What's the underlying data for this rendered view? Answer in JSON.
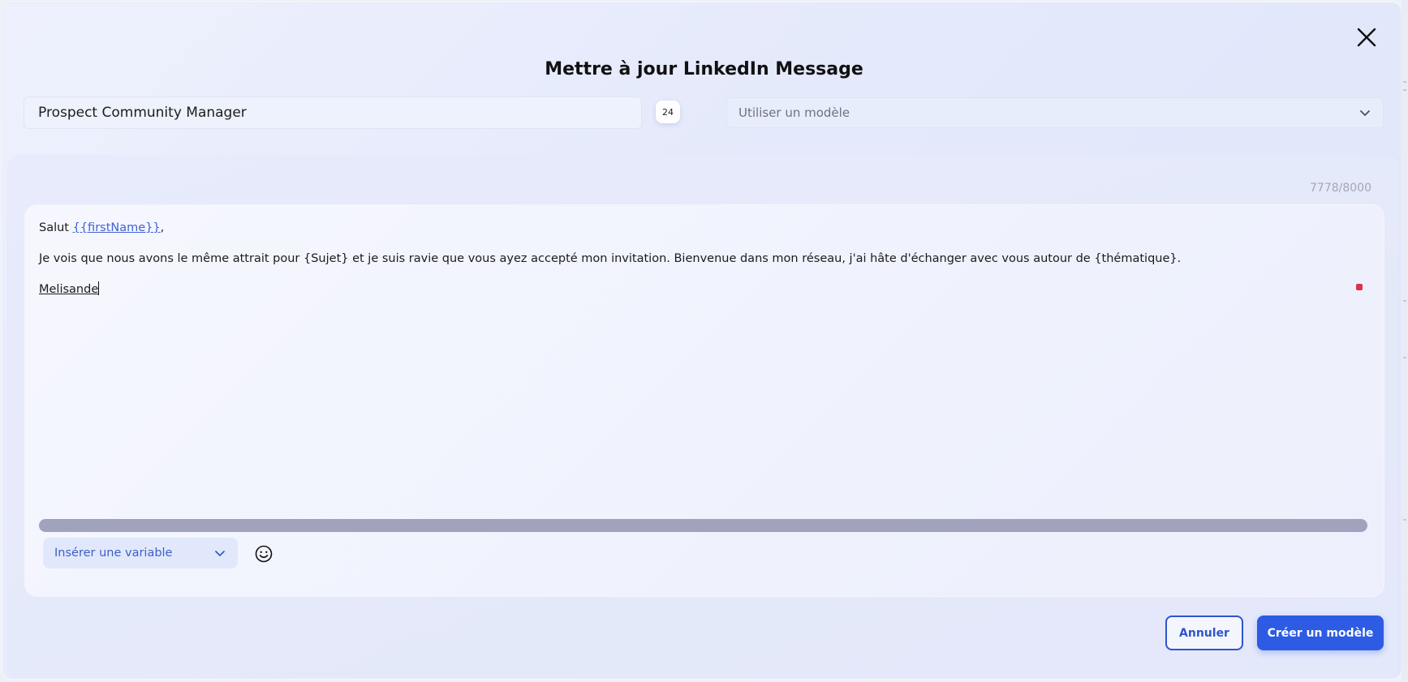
{
  "modal": {
    "title": "Mettre à jour LinkedIn Message",
    "close_icon": "close-icon"
  },
  "name_field": {
    "value": "Prospect Community Manager",
    "length_badge": "24"
  },
  "template_select": {
    "placeholder": "Utiliser un modèle",
    "icon": "chevron-down-icon"
  },
  "editor": {
    "char_count": "7778/8000",
    "greeting_prefix": "Salut ",
    "greeting_variable": "{{firstName}}",
    "greeting_suffix": ",",
    "body": "Je vois que nous avons le même attrait pour {Sujet} et je suis ravie que vous ayez accepté mon invitation. Bienvenue dans mon réseau, j'ai hâte d'échanger avec vous autour de {thématique}.",
    "signature": "Melisande"
  },
  "toolbar": {
    "insert_variable_label": "Insérer une variable",
    "emoji_icon": "smiley-icon"
  },
  "actions": {
    "cancel_label": "Annuler",
    "create_template_label": "Créer un modèle"
  },
  "colors": {
    "accent": "#2d5be3",
    "variable_text": "#3f63d3",
    "indicator": "#d8344e"
  }
}
